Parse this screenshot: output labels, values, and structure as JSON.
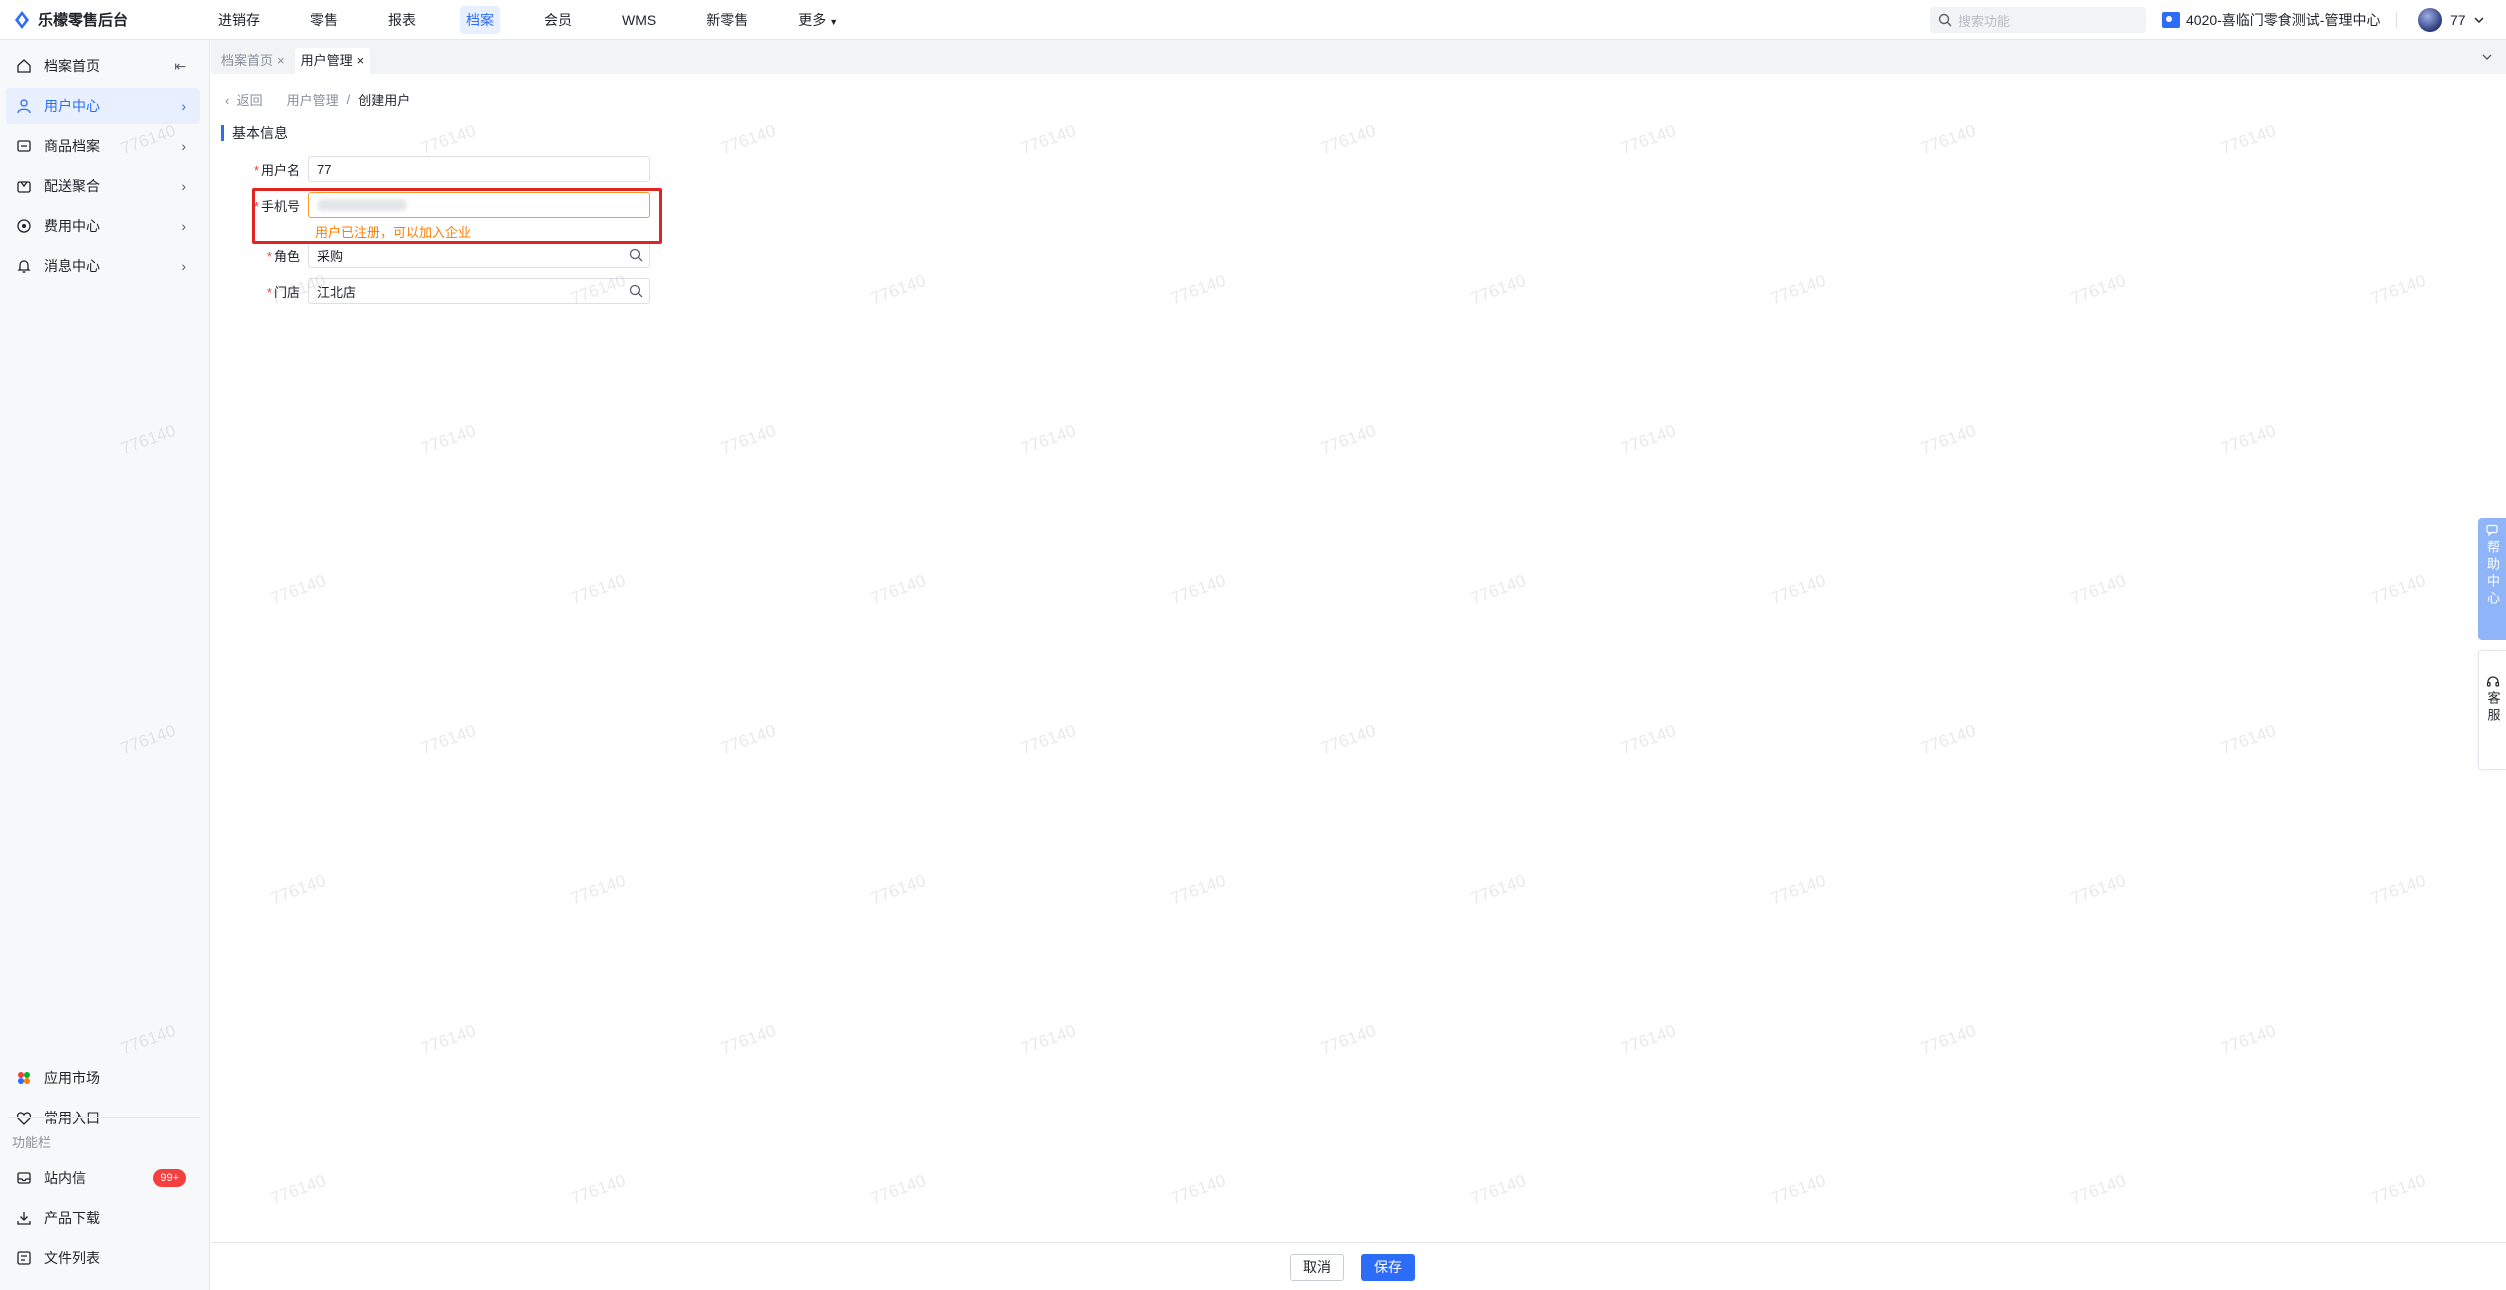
{
  "app": {
    "brand": "乐檬零售后台"
  },
  "topnav": {
    "items": [
      "进销存",
      "零售",
      "报表",
      "档案",
      "会员",
      "WMS",
      "新零售",
      "更多"
    ],
    "active_index": 3,
    "search_placeholder": "搜索功能",
    "org": "4020-喜临门零食测试-管理中心",
    "user": "77"
  },
  "sidebar": {
    "items": [
      {
        "label": "档案首页",
        "icon": "home-icon"
      },
      {
        "label": "用户中心",
        "icon": "user-icon"
      },
      {
        "label": "商品档案",
        "icon": "box-icon"
      },
      {
        "label": "配送聚合",
        "icon": "delivery-icon"
      },
      {
        "label": "费用中心",
        "icon": "money-icon"
      },
      {
        "label": "消息中心",
        "icon": "bell-icon"
      }
    ],
    "active_index": 1,
    "bottom": {
      "app_market": "应用市场",
      "favorites": "常用入口",
      "section_label": "功能栏",
      "inbox": "站内信",
      "inbox_badge": "99+",
      "download": "产品下载",
      "files": "文件列表"
    }
  },
  "tabs": [
    {
      "label": "档案首页",
      "active": false
    },
    {
      "label": "用户管理",
      "active": true
    }
  ],
  "breadcrumb": {
    "back": "返回",
    "parent": "用户管理",
    "sep": "/",
    "current": "创建用户"
  },
  "form": {
    "section_title": "基本信息",
    "username": {
      "label": "用户名",
      "value": "77"
    },
    "phone": {
      "label": "手机号",
      "hint": "用户已注册，可以加入企业"
    },
    "role": {
      "label": "角色",
      "value": "采购"
    },
    "store": {
      "label": "门店",
      "value": "江北店"
    }
  },
  "footer": {
    "cancel": "取消",
    "save": "保存"
  },
  "floaters": {
    "help": "帮助中心",
    "service": "客服"
  },
  "watermark": "776140",
  "colors": {
    "primary": "#2d6cf6",
    "warning": "#ff7d00",
    "danger": "#f53f3f",
    "highlight": "#e02424"
  }
}
